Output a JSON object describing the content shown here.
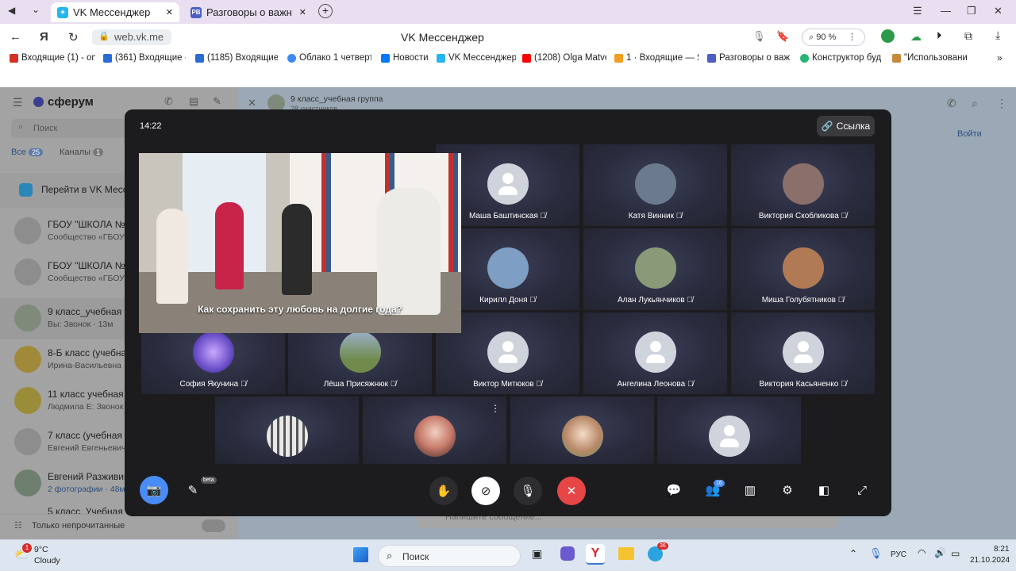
{
  "browser": {
    "tabs": [
      {
        "label": "VK Мессенджер",
        "active": true
      },
      {
        "label": "Разговоры о важном",
        "active": false
      }
    ],
    "url": "web.vk.me",
    "page_title": "VK Мессенджер",
    "zoom": "90 %",
    "bookmarks": [
      {
        "label": "Входящие (1) - on",
        "color": "#d93025"
      },
      {
        "label": "(361) Входящие -",
        "color": "#2a6cd6"
      },
      {
        "label": "(1185) Входящие",
        "color": "#2a6cd6"
      },
      {
        "label": "Облако 1 четверт",
        "color": "#3d8af7"
      },
      {
        "label": "Новости",
        "color": "#0077ff"
      },
      {
        "label": "VK Мессенджер",
        "color": "#27b5f0"
      },
      {
        "label": "(1208) Olga Matve",
        "color": "#ff0000"
      },
      {
        "label": "1 · Входящие — Я",
        "color": "#f0a020"
      },
      {
        "label": "Разговоры о важ",
        "color": "#4b5fc4"
      },
      {
        "label": "Конструктор буд",
        "color": "#22b573"
      },
      {
        "label": "\"Использовани",
        "color": "#c88a3a"
      }
    ]
  },
  "sidebar": {
    "brand": "сферум",
    "search_placeholder": "Поиск",
    "filters": [
      {
        "label": "Все",
        "count": "25"
      },
      {
        "label": "Каналы",
        "count": "1"
      }
    ],
    "promo": "Перейти в VK Месс",
    "chats": [
      {
        "title": "ГБОУ \"ШКОЛА № 2",
        "sub": "Сообщество «ГБОУ"
      },
      {
        "title": "ГБОУ \"ШКОЛА № 2",
        "sub": "Сообщество «ГБОУ"
      },
      {
        "title": "9 класс_учебная гр",
        "sub": "Вы: Звонок · 13м"
      },
      {
        "title": "8-Б класс (учебная",
        "sub": "Ирина-Васильевна"
      },
      {
        "title": "11 класс учебная г",
        "sub": "Людмила Е: Звонок"
      },
      {
        "title": "7 класс (учебная г",
        "sub": "Евгений Евгеньевич"
      },
      {
        "title": "Евгений Разживин",
        "sub": "2 фотографии · 48м"
      },
      {
        "title": "5 класс. Учебная г",
        "sub": ""
      }
    ],
    "unread_toggle": "Только непрочитанные"
  },
  "chat": {
    "title": "9 класс_учебная группа",
    "members": "28 участников",
    "join_button": "Войти",
    "message_placeholder": "Напишите сообщение..."
  },
  "call": {
    "time": "14:22",
    "link_button": "Ссылка",
    "caption": "Как сохранить эту любовь на долгие года?",
    "participants_count": "16",
    "beta": "beta",
    "participants": [
      {
        "name": "Маша Баштинская",
        "avatar": "placeholder"
      },
      {
        "name": "Катя Винник",
        "avatar": "photo",
        "color": "#6b7a8c"
      },
      {
        "name": "Виктория Скобликова",
        "avatar": "photo",
        "color": "#8a6f6a"
      },
      {
        "name": "Кирилл Доня",
        "avatar": "photo",
        "color": "#7e9ec4"
      },
      {
        "name": "Алан Лукьянчиков",
        "avatar": "photo",
        "color": "#8a9a78"
      },
      {
        "name": "Миша Голубятников",
        "avatar": "photo",
        "color": "#b07a55"
      },
      {
        "name": "София Якунина",
        "avatar": "photo",
        "color": "#6b4fc8"
      },
      {
        "name": "Лёша Присяжнюк",
        "avatar": "photo",
        "color": "#6f8a4a"
      },
      {
        "name": "Виктор Митюков",
        "avatar": "placeholder"
      },
      {
        "name": "Ангелина Леонова",
        "avatar": "placeholder"
      },
      {
        "name": "Виктория Касьяненко",
        "avatar": "placeholder"
      },
      {
        "name": "",
        "avatar": "photo",
        "color": "#9a9a9a"
      },
      {
        "name": "",
        "avatar": "photo",
        "color": "#c77a6a"
      },
      {
        "name": "",
        "avatar": "photo",
        "color": "#b98a6a"
      },
      {
        "name": "",
        "avatar": "placeholder"
      }
    ]
  },
  "taskbar": {
    "weather_temp": "9°C",
    "weather_desc": "Cloudy",
    "weather_badge": "1",
    "search": "Поиск",
    "telegram_badge": "36",
    "lang": "РУС",
    "time": "8:21",
    "date": "21.10.2024"
  },
  "colors": {
    "accent_vk": "#0077ff",
    "end_call": "#e64646",
    "call_bg": "#1c1c1f"
  }
}
